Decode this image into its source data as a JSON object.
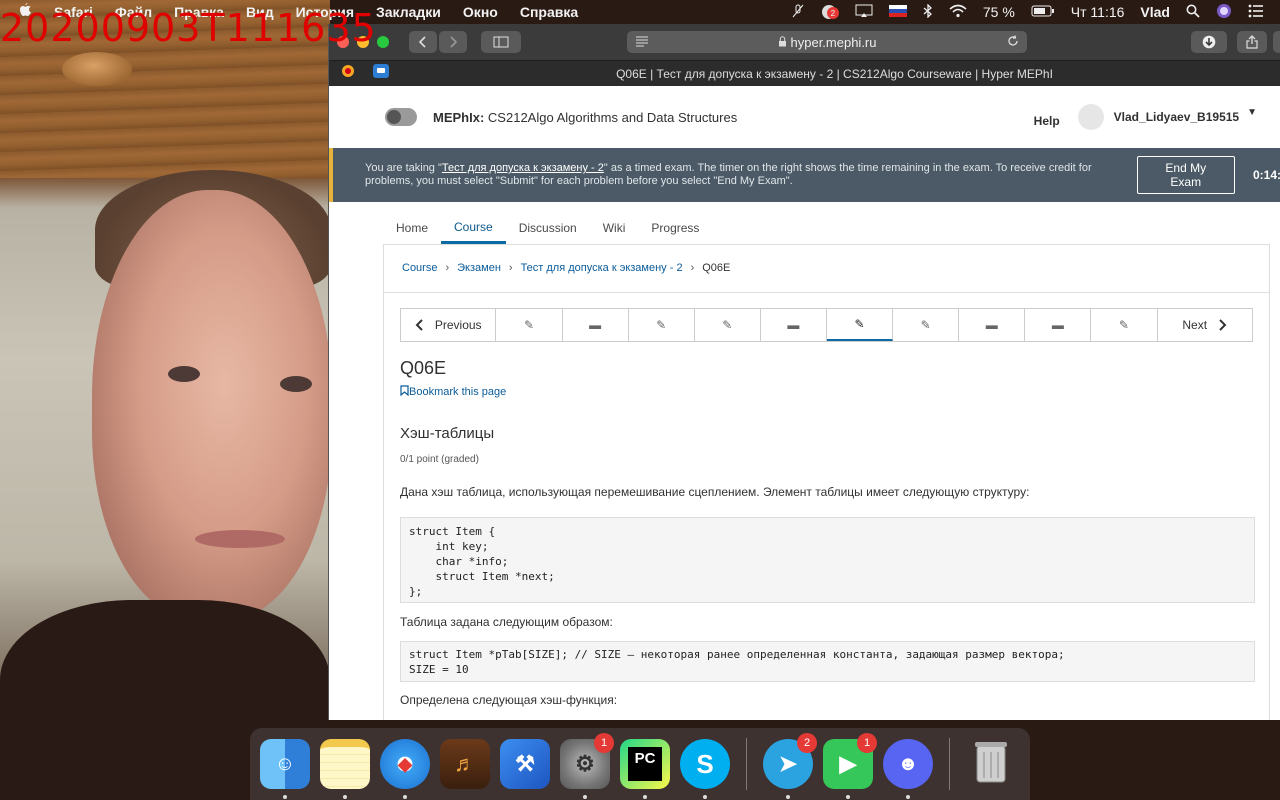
{
  "overlay_timestamp": "20200903T111635",
  "menubar": {
    "apple": "",
    "items": [
      "Safari",
      "Файл",
      "Правка",
      "Вид",
      "История",
      "Закладки",
      "Окно",
      "Справка"
    ],
    "battery": "75 %",
    "clock": "Чт 11:16",
    "user": "Vlad",
    "notif_count": "2"
  },
  "browser": {
    "url": "hyper.mephi.ru",
    "tab_title": "Q06E | Тест для допуска к экзамену - 2 | CS212Algo Courseware | Hyper MEPhI"
  },
  "header": {
    "org": "MEPhIx:",
    "course": "CS212Algo Algorithms and Data Structures",
    "help": "Help",
    "username": "Vlad_Lidyaev_B19515"
  },
  "exam": {
    "text_before": "You are taking \"",
    "exam_name": "Тест для допуска к экзамену - 2",
    "text_after": "\" as a timed exam. The timer on the right shows the time remaining in the exam. To receive credit for problems, you must select \"Submit\" for each problem before you select \"End My Exam\".",
    "end_button": "End My Exam",
    "timer": "0:14:"
  },
  "tabs": [
    "Home",
    "Course",
    "Discussion",
    "Wiki",
    "Progress"
  ],
  "breadcrumb": [
    "Course",
    "Экзамен",
    "Тест для допуска к экзамену - 2",
    "Q06E"
  ],
  "seq": {
    "previous": "Previous",
    "next": "Next"
  },
  "unit_title": "Q06E",
  "bookmark": "Bookmark this page",
  "problem": {
    "title": "Хэш-таблицы",
    "points": "0/1 point (graded)",
    "p1": "Дана хэш таблица, использующая перемешивание сцеплением. Элемент таблицы имеет следующую структуру:",
    "code1": "struct Item {\n    int key;\n    char *info;\n    struct Item *next;\n};",
    "p2": "Таблица задана следующим образом:",
    "code2": "struct Item *pTab[SIZE]; // SIZE – некоторая ранее определенная константа, задающая размер вектора;\nSIZE = 10",
    "p3": "Определена следующая хэш-функция:"
  },
  "dock": {
    "system_prefs_badge": "1",
    "telegram_badge": "2",
    "facetime_badge": "1",
    "pycharm_label": "PC"
  },
  "colors": {
    "accent": "#0d6ba3",
    "banner": "#4b5a66",
    "banner_stripe": "#e5b23a",
    "timestamp": "#e10000"
  }
}
